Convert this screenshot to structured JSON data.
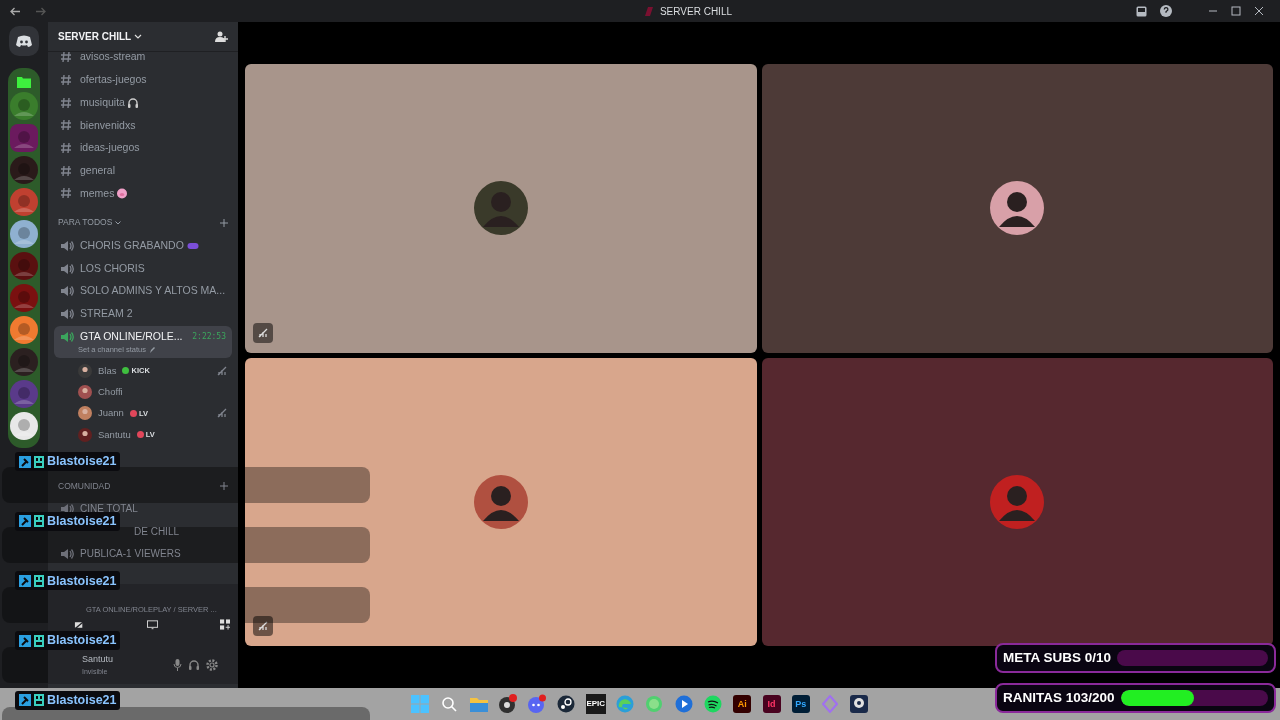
{
  "window": {
    "title": "SERVER CHILL"
  },
  "servers": [
    {
      "selected": false
    },
    {
      "selected": true
    },
    {
      "selected": false
    },
    {
      "selected": false
    },
    {
      "selected": false
    },
    {
      "selected": false
    },
    {
      "selected": false
    },
    {
      "selected": false
    },
    {
      "selected": false
    },
    {
      "selected": false
    },
    {
      "selected": false
    }
  ],
  "server_header": {
    "name": "SERVER CHILL"
  },
  "text_channels": [
    {
      "name": "avisos-stream",
      "kind": "plain"
    },
    {
      "name": "ofertas-juegos",
      "kind": "plain"
    },
    {
      "name": "musiquita",
      "kind": "headphones"
    },
    {
      "name": "bienvenidxs",
      "kind": "plain"
    },
    {
      "name": "ideas-juegos",
      "kind": "plain"
    },
    {
      "name": "general",
      "kind": "plain"
    },
    {
      "name": "memes",
      "kind": "pig"
    }
  ],
  "category": {
    "name": "PARA TODOS",
    "expanded": true
  },
  "voice_channels": [
    {
      "name": "CHORIS GRABANDO",
      "kind": "gamepad",
      "selected": false
    },
    {
      "name": "LOS CHORIS",
      "kind": "plain",
      "selected": false
    },
    {
      "name": "SOLO ADMINS Y ALTOS MA...",
      "kind": "plain",
      "selected": false
    },
    {
      "name": "STREAM 2",
      "kind": "plain",
      "selected": false
    },
    {
      "name": "GTA ONLINE/ROLE...",
      "kind": "plain",
      "selected": true,
      "time": "2:22:53",
      "status": "Set a channel status"
    }
  ],
  "voice_users": [
    {
      "name": "Blas",
      "tag": "KICK",
      "color": "#3fbf3f",
      "deafened": true
    },
    {
      "name": "Choffi",
      "deafened": false
    },
    {
      "name": "Juann",
      "tag": "LV",
      "color": "#e0465a",
      "deafened": true
    },
    {
      "name": "Santutu",
      "tag": "LV",
      "color": "#e0465a",
      "deafened": false
    }
  ],
  "lower_category": {
    "name": "COMUNIDAD"
  },
  "lower_channels": [
    {
      "name": "CINE TOTAL"
    },
    {
      "name": "DE CHILL"
    },
    {
      "name": "PUBLICA-1 VIEWERS"
    }
  ],
  "voice_panel": {
    "channel": "GTA ONLINE/ROLEPLAY / SERVER ..."
  },
  "user_panel": {
    "name": "Santutu",
    "status": "Invisible"
  },
  "chat_overlay": [
    "Blastoise21",
    "Blastoise21",
    "Blastoise21",
    "Blastoise21",
    "Blastoise21"
  ],
  "tiles": [
    {
      "muted": true
    },
    {
      "muted": false
    },
    {
      "muted": true
    },
    {
      "muted": false
    }
  ],
  "goals": [
    {
      "label": "META SUBS 0/10",
      "level": 0
    },
    {
      "label": "RANITAS 103/200",
      "level": 0.5
    }
  ],
  "taskbar": [
    {
      "kind": "start"
    },
    {
      "kind": "search"
    },
    {
      "kind": "folder"
    },
    {
      "kind": "obs"
    },
    {
      "kind": "discord"
    },
    {
      "kind": "steam"
    },
    {
      "kind": "epic",
      "label": "EPIC"
    },
    {
      "kind": "edge"
    },
    {
      "kind": "whatsapp"
    },
    {
      "kind": "blue"
    },
    {
      "kind": "spotify"
    },
    {
      "kind": "adobe",
      "label": "Ai"
    },
    {
      "kind": "adobe",
      "label": "Id"
    },
    {
      "kind": "adobe",
      "label": "Ps"
    },
    {
      "kind": "diamond"
    },
    {
      "kind": "webcam"
    }
  ]
}
